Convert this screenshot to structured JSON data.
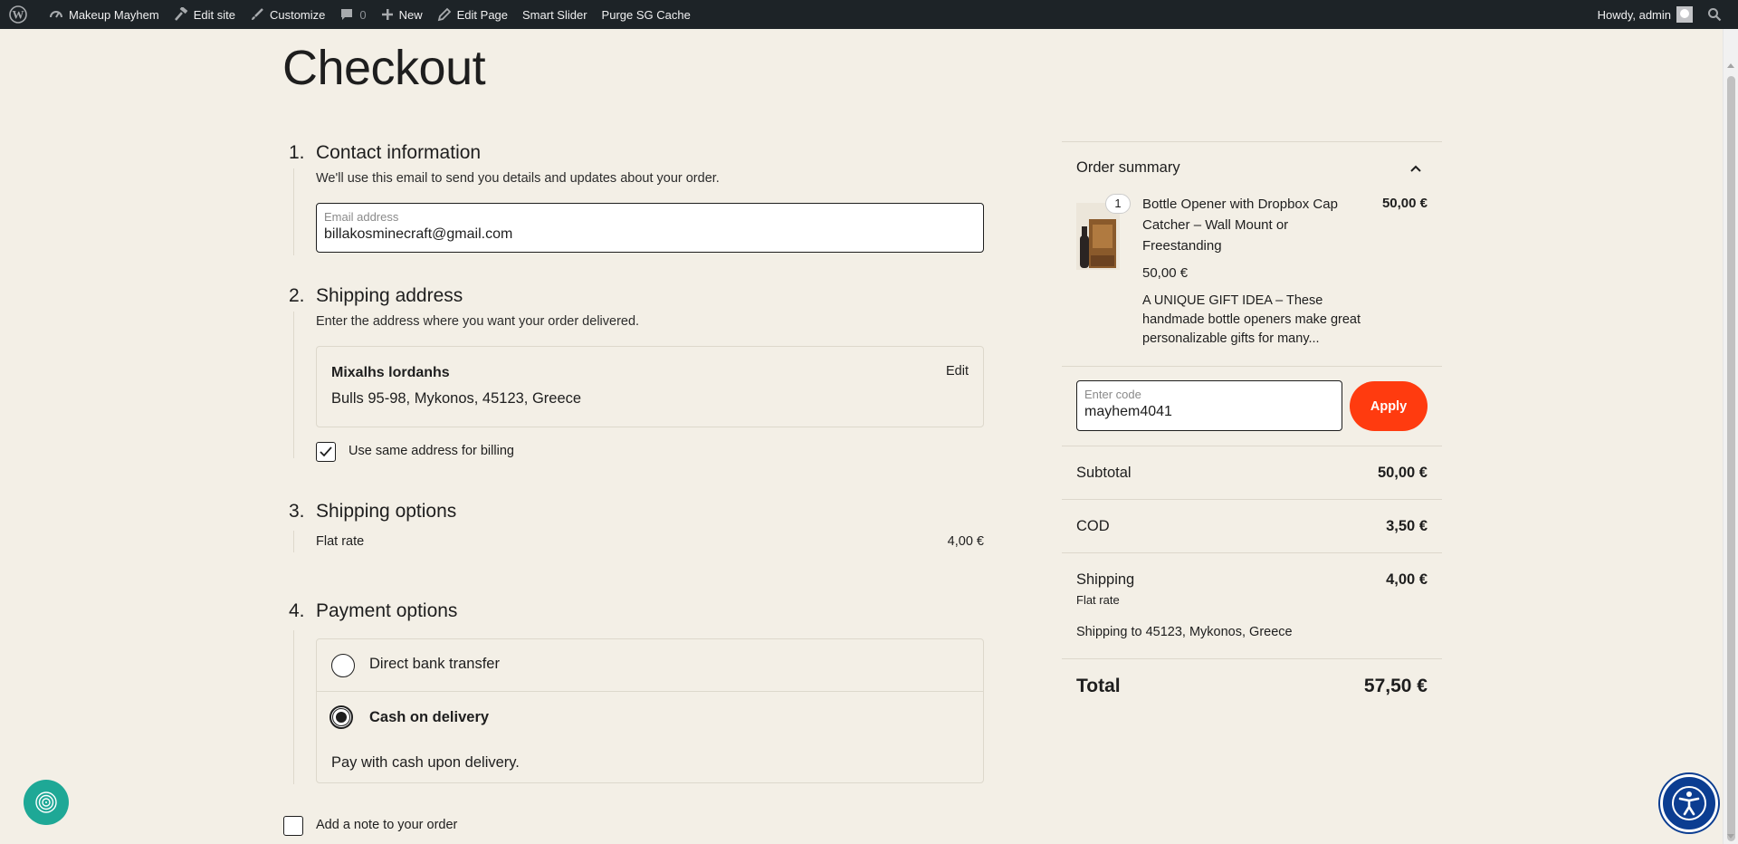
{
  "adminbar": {
    "site_name": "Makeup Mayhem",
    "edit_site": "Edit site",
    "customize": "Customize",
    "comments_count": "0",
    "new": "New",
    "edit_page": "Edit Page",
    "smart_slider": "Smart Slider",
    "purge_cache": "Purge SG Cache",
    "howdy": "Howdy, admin"
  },
  "page": {
    "title": "Checkout"
  },
  "contact": {
    "number": "1.",
    "title": "Contact information",
    "description": "We'll use this email to send you details and updates about your order.",
    "email_label": "Email address",
    "email_value": "billakosminecraft@gmail.com"
  },
  "shipping_address": {
    "number": "2.",
    "title": "Shipping address",
    "description": "Enter the address where you want your order delivered.",
    "name": "Mixalhs lordanhs",
    "address": "Bulls 95-98, Mykonos, 45123, Greece",
    "edit_label": "Edit",
    "same_billing_label": "Use same address for billing",
    "same_billing_checked": true
  },
  "shipping_options": {
    "number": "3.",
    "title": "Shipping options",
    "method": "Flat rate",
    "price": "4,00 €"
  },
  "payment": {
    "number": "4.",
    "title": "Payment options",
    "options": [
      {
        "label": "Direct bank transfer",
        "selected": false
      },
      {
        "label": "Cash on delivery",
        "selected": true
      }
    ],
    "selected_description": "Pay with cash upon delivery."
  },
  "order_note": {
    "label": "Add a note to your order",
    "checked": false
  },
  "summary": {
    "title": "Order summary",
    "item": {
      "quantity": "1",
      "name": "Bottle Opener with Dropbox Cap Catcher – Wall Mount or Freestanding",
      "total": "50,00 €",
      "unit_price": "50,00 €",
      "description": "A UNIQUE GIFT IDEA – These handmade bottle openers make great personalizable gifts for many..."
    },
    "coupon": {
      "label": "Enter code",
      "value": "mayhem4041",
      "apply": "Apply"
    },
    "subtotal_label": "Subtotal",
    "subtotal": "50,00 €",
    "cod_label": "COD",
    "cod": "3,50 €",
    "shipping_label": "Shipping",
    "shipping": "4,00 €",
    "shipping_method": "Flat rate",
    "shipping_to": "Shipping to 45123, Mykonos, Greece",
    "total_label": "Total",
    "total": "57,50 €"
  },
  "colors": {
    "accent": "#ff3b0f",
    "background": "#f3efe6",
    "adminbar": "#1d2327",
    "a11y": "#0b3d91",
    "widget": "#1ea896"
  }
}
